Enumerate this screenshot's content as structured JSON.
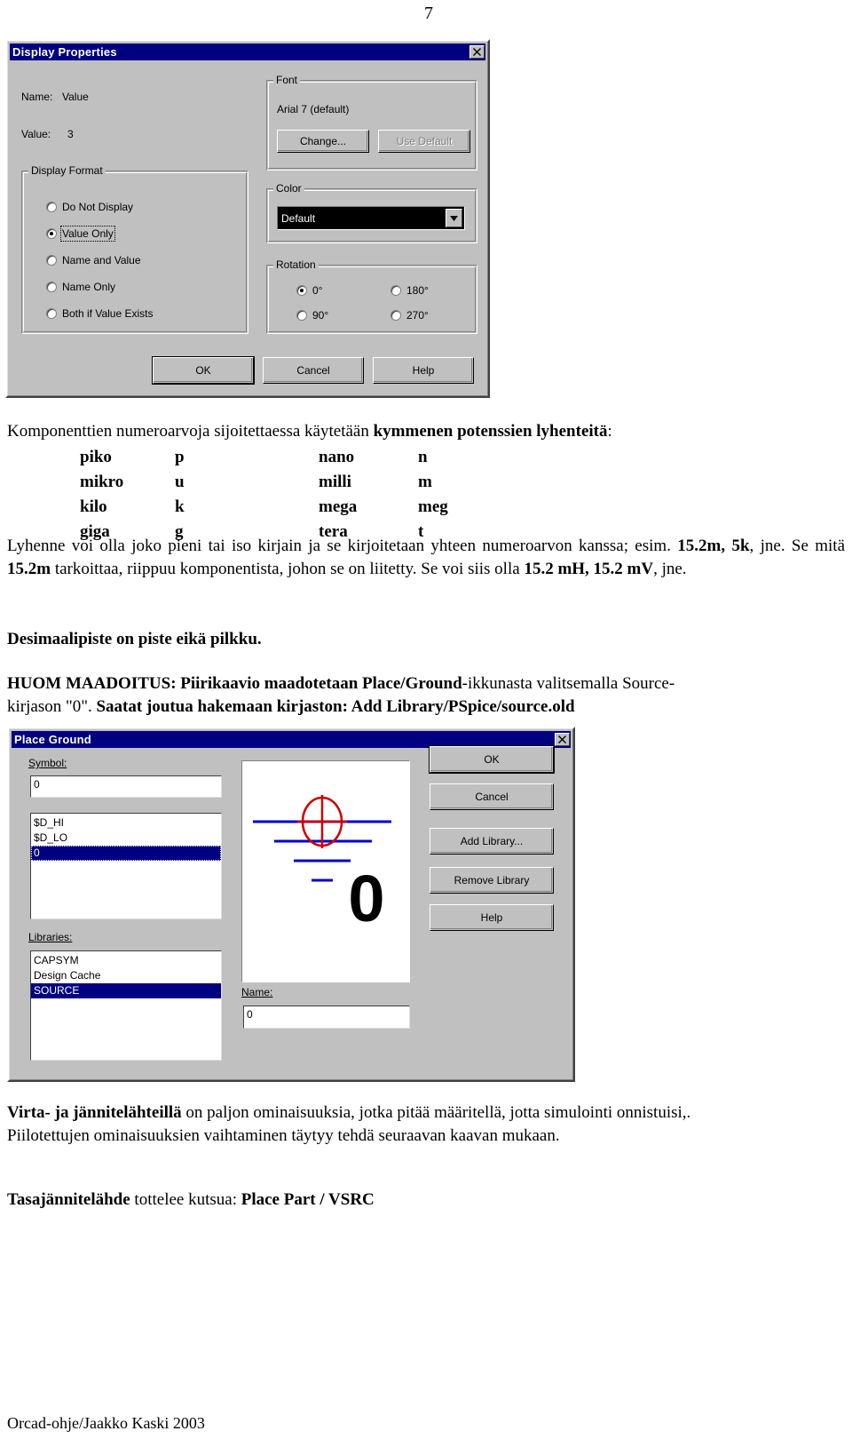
{
  "page": {
    "number": "7",
    "footer": "Orcad-ohje/Jaakko Kaski 2003"
  },
  "display_properties_dialog": {
    "title": "Display Properties",
    "close_icon": "close-icon",
    "name_label": "Name:",
    "name_value": "Value",
    "value_label": "Value:",
    "value_value": "3",
    "display_format": {
      "legend": "Display Format",
      "options": [
        {
          "label": "Do Not Display",
          "mnemonic": "D",
          "checked": false,
          "focused": false
        },
        {
          "label": "Value Only",
          "mnemonic": "V",
          "checked": true,
          "focused": true
        },
        {
          "label": "Name and Value",
          "mnemonic": "e",
          "checked": false,
          "focused": false
        },
        {
          "label": "Name Only",
          "mnemonic": "N",
          "checked": false,
          "focused": false
        },
        {
          "label": "Both if Value Exists",
          "mnemonic": "B",
          "checked": false,
          "focused": false
        }
      ]
    },
    "font": {
      "legend": "Font",
      "current": "Arial 7 (default)",
      "change_button": "Change...",
      "use_default_button": "Use Default",
      "use_default_disabled": true
    },
    "color": {
      "legend": "Color",
      "selected": "Default",
      "dropdown_icon": "chevron-down-icon",
      "swatch_hex": "#000000"
    },
    "rotation": {
      "legend": "Rotation",
      "options": [
        {
          "label": "0°",
          "checked": true
        },
        {
          "label": "180°",
          "checked": false
        },
        {
          "label": "90°",
          "checked": false
        },
        {
          "label": "270°",
          "checked": false
        }
      ]
    },
    "buttons": {
      "ok": "OK",
      "cancel": "Cancel",
      "help": "Help"
    }
  },
  "prose": {
    "intro_plain": "Komponenttien numeroarvoja sijoitettaessa käytetään ",
    "intro_bold": "kymmenen potenssien lyhenteitä",
    "intro_tail": ":",
    "abbrev_rows": [
      {
        "name_a": "piko",
        "sym_a": "p",
        "name_b": "nano",
        "sym_b": "n"
      },
      {
        "name_a": "mikro",
        "sym_a": "u",
        "name_b": "milli",
        "sym_b": "m"
      },
      {
        "name_a": "kilo",
        "sym_a": "k",
        "name_b": "mega",
        "sym_b": "meg"
      },
      {
        "name_a": "giga",
        "sym_a": "g",
        "name_b": "tera",
        "sym_b": "t"
      }
    ],
    "para1_line1": "Lyhenne voi olla joko pieni tai iso kirjain ja se kirjoitetaan yhteen numeroarvon kanssa; esim.",
    "para1_b1": "15.2m, 5k",
    "para1_t1": ", jne. Se mitä ",
    "para1_b2": "15.2m",
    "para1_t2": " tarkoittaa, riippuu komponentista, johon se on liitetty. Se voi siis olla",
    "para1_b3": "15.2 mH, 15.2 mV",
    "para1_t3": ", jne.",
    "para2_bold": "Desimaalipiste on  piste eikä pilkku.",
    "huom_b1": "HUOM MAADOITUS: Piirikaavio maadotetaan Place/Ground",
    "huom_t1": "-ikkunasta valitsemalla Source-",
    "huom_t2": "kirjason \"0\". ",
    "huom_b2": "Saatat joutua hakemaan kirjaston: Add Library/PSpice/source.old",
    "closing_b1": "Virta- ja jännitelähteillä",
    "closing_t1": " on paljon ominaisuuksia, jotka pitää määritellä, jotta simulointi onnistuisi,.",
    "closing_t2": "Piilotettujen ominaisuuksien vaihtaminen täytyy tehdä seuraavan kaavan mukaan.",
    "final_b1": "Tasajännitelähde",
    "final_t1": " tottelee kutsua: ",
    "final_b2": "Place Part / VSRC"
  },
  "place_ground_dialog": {
    "title": "Place Ground",
    "close_icon": "close-icon",
    "symbol_label": "Symbol:",
    "symbol_value": "0",
    "symbol_list": [
      {
        "label": "$D_HI",
        "selected": false
      },
      {
        "label": "$D_LO",
        "selected": false
      },
      {
        "label": "0",
        "selected": true
      }
    ],
    "libraries_label": "Libraries:",
    "libraries_list": [
      {
        "label": "CAPSYM",
        "selected": false
      },
      {
        "label": "Design Cache",
        "selected": false
      },
      {
        "label": "SOURCE",
        "selected": true
      }
    ],
    "name_label": "Name:",
    "name_value": "0",
    "preview": {
      "symbol_glyph": "0",
      "wire_color": "#0000cc",
      "marker_color": "#cc0000"
    },
    "buttons": [
      {
        "label": "OK",
        "mnemonic": "",
        "default": true
      },
      {
        "label": "Cancel",
        "mnemonic": "",
        "default": false
      },
      {
        "label": "Add Library...",
        "mnemonic": "A",
        "default": false
      },
      {
        "label": "Remove Library",
        "mnemonic": "R",
        "default": false
      },
      {
        "label": "Help",
        "mnemonic": "H",
        "default": false
      }
    ]
  }
}
